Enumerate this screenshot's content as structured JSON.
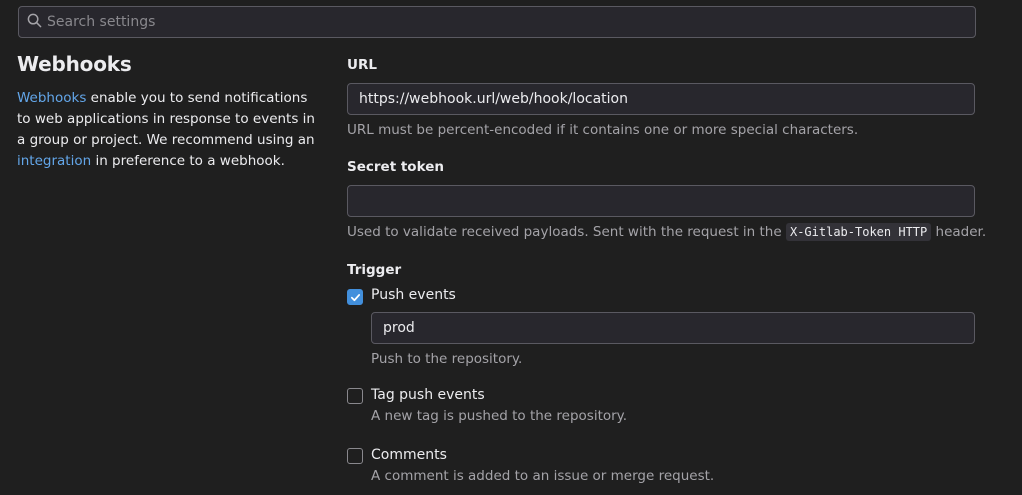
{
  "search": {
    "placeholder": "Search settings",
    "icon": "search-icon"
  },
  "sidebar": {
    "title": "Webhooks",
    "desc_link1": "Webhooks",
    "desc_part1": " enable you to send notifications to web applications in response to events in a group or project. We recommend using an ",
    "desc_link2": "integration",
    "desc_part2": " in preference to a webhook."
  },
  "form": {
    "url": {
      "label": "URL",
      "value": "https://webhook.url/web/hook/location",
      "help": "URL must be percent-encoded if it contains one or more special characters."
    },
    "secret": {
      "label": "Secret token",
      "value": "",
      "help_before": "Used to validate received payloads. Sent with the request in the ",
      "help_code": "X-Gitlab-Token HTTP",
      "help_after": " header."
    },
    "trigger": {
      "label": "Trigger",
      "push": {
        "label": "Push events",
        "checked": true,
        "branch_filter": "prod",
        "help": "Push to the repository."
      },
      "tag_push": {
        "label": "Tag push events",
        "checked": false,
        "help": "A new tag is pushed to the repository."
      },
      "comments": {
        "label": "Comments",
        "checked": false,
        "help": "A comment is added to an issue or merge request."
      }
    }
  },
  "colors": {
    "accent": "#428fdc",
    "link": "#63a6e9",
    "background": "#1f1f1f"
  }
}
